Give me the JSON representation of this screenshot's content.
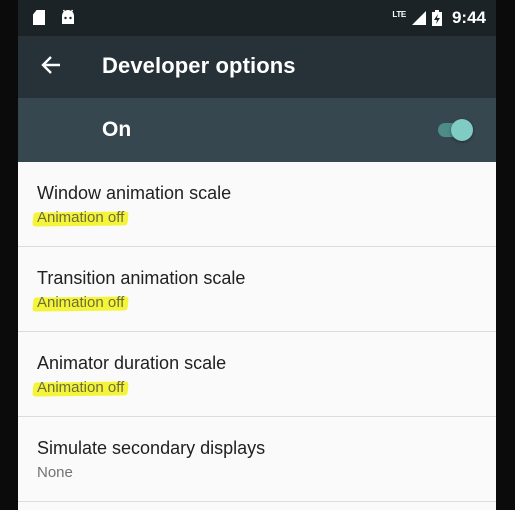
{
  "status_bar": {
    "network": "LTE",
    "time": "9:44",
    "icons": [
      "sd-card-icon",
      "android-icon",
      "signal-icon",
      "battery-charging-icon"
    ]
  },
  "app_bar": {
    "back_icon": "arrow-back-icon",
    "title": "Developer options"
  },
  "master_switch": {
    "label": "On",
    "state": "on"
  },
  "settings": [
    {
      "title": "Window animation scale",
      "summary": "Animation off",
      "highlighted": true
    },
    {
      "title": "Transition animation scale",
      "summary": "Animation off",
      "highlighted": true
    },
    {
      "title": "Animator duration scale",
      "summary": "Animation off",
      "highlighted": true
    },
    {
      "title": "Simulate secondary displays",
      "summary": "None",
      "highlighted": false
    }
  ],
  "colors": {
    "status_bar": "#1b2327",
    "app_bar": "#263238",
    "switch_bar": "#37474f",
    "toggle_thumb": "#80cbc4",
    "highlight": "#f4f53a"
  }
}
